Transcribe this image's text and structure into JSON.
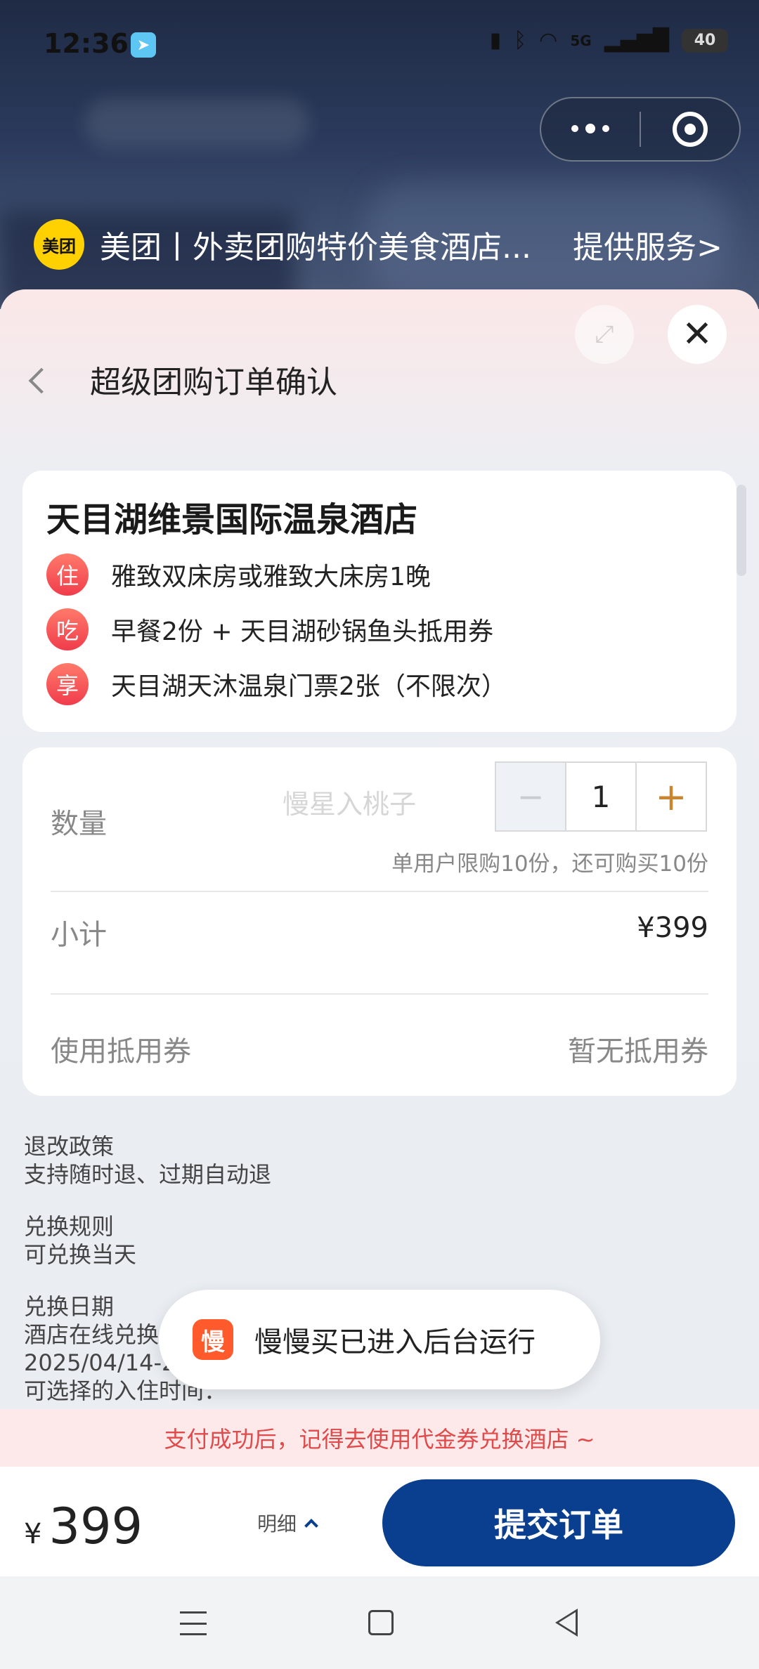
{
  "status_bar": {
    "time": "12:36",
    "telegram_icon": "telegram-icon",
    "network": "5G",
    "battery": "40"
  },
  "mini_program": {
    "logo_text": "美团",
    "title": "美团丨外卖团购特价美食酒店...",
    "service_label": "提供服务",
    "service_chevron": ">"
  },
  "sheet": {
    "title": "超级团购订单确认",
    "expand_icon": "⤢",
    "close_icon": "✕"
  },
  "package": {
    "hotel_name": "天目湖维景国际温泉酒店",
    "perks": [
      {
        "badge": "住",
        "text": "雅致双床房或雅致大床房1晚"
      },
      {
        "badge": "吃",
        "text": "早餐2份 + 天目湖砂锅鱼头抵用券"
      },
      {
        "badge": "享",
        "text": "天目湖天沐温泉门票2张（不限次）"
      }
    ]
  },
  "order": {
    "quantity_label": "数量",
    "watermark": "慢星入桃子",
    "minus": "−",
    "quantity_value": "1",
    "plus": "+",
    "limit_text": "单用户限购10份，还可购买10份",
    "subtotal_label": "小计",
    "subtotal_value": "¥399",
    "coupon_label": "使用抵用券",
    "coupon_value": "暂无抵用券"
  },
  "policies": {
    "refund_title": "退改政策",
    "refund_text": "支持随时退、过期自动退",
    "exchange_title": "兑换规则",
    "exchange_text": "可兑换当天",
    "date_title": "兑换日期",
    "date_line1": "酒店在线兑换",
    "date_line2": "2025/04/14-2",
    "checkin_text": "可选择的入住时间："
  },
  "toast": {
    "app_icon_text": "慢",
    "message": "慢慢买已进入后台运行"
  },
  "tip": "支付成功后，记得去使用代金券兑换酒店 ~",
  "bottom_bar": {
    "currency": "¥",
    "price": "399",
    "detail_label": "明细",
    "submit_label": "提交订单"
  },
  "colors": {
    "primary": "#0a3f8f",
    "accent_red": "#e14a4a",
    "plus_orange": "#c9852f",
    "meituan_yellow": "#ffd100"
  }
}
